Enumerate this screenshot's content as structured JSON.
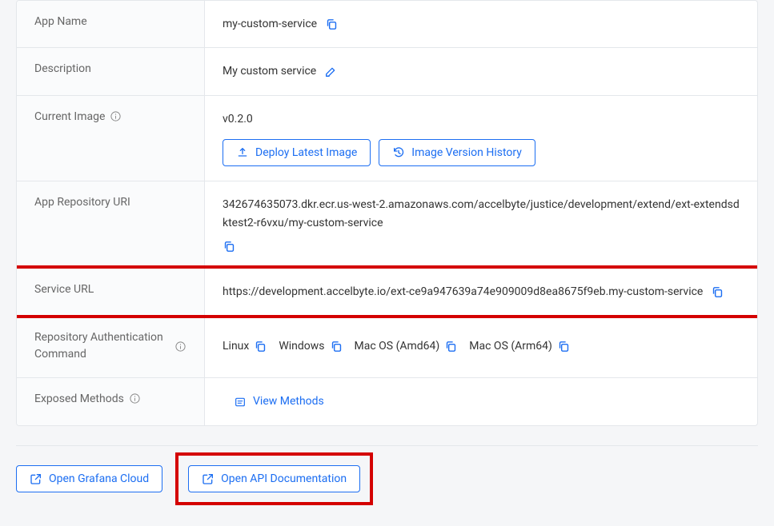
{
  "rows": {
    "appName": {
      "label": "App Name",
      "value": "my-custom-service"
    },
    "description": {
      "label": "Description",
      "value": "My custom service"
    },
    "currentImage": {
      "label": "Current Image",
      "value": "v0.2.0",
      "deployBtn": "Deploy Latest Image",
      "historyBtn": "Image Version History"
    },
    "appRepoUri": {
      "label": "App Repository URI",
      "value": "342674635073.dkr.ecr.us-west-2.amazonaws.com/accelbyte/justice/development/extend/ext-extendsdktest2-r6vxu/my-custom-service"
    },
    "serviceUrl": {
      "label": "Service URL",
      "value": "https://development.accelbyte.io/ext-ce9a947639a74e909009d8ea8675f9eb.my-custom-service"
    },
    "repoAuthCmd": {
      "label": "Repository Authentication Command",
      "os": {
        "linux": "Linux",
        "windows": "Windows",
        "macAmd": "Mac OS (Amd64)",
        "macArm": "Mac OS (Arm64)"
      }
    },
    "exposedMethods": {
      "label": "Exposed Methods",
      "viewLink": "View Methods"
    }
  },
  "footer": {
    "grafana": "Open Grafana Cloud",
    "apiDocs": "Open API Documentation"
  }
}
